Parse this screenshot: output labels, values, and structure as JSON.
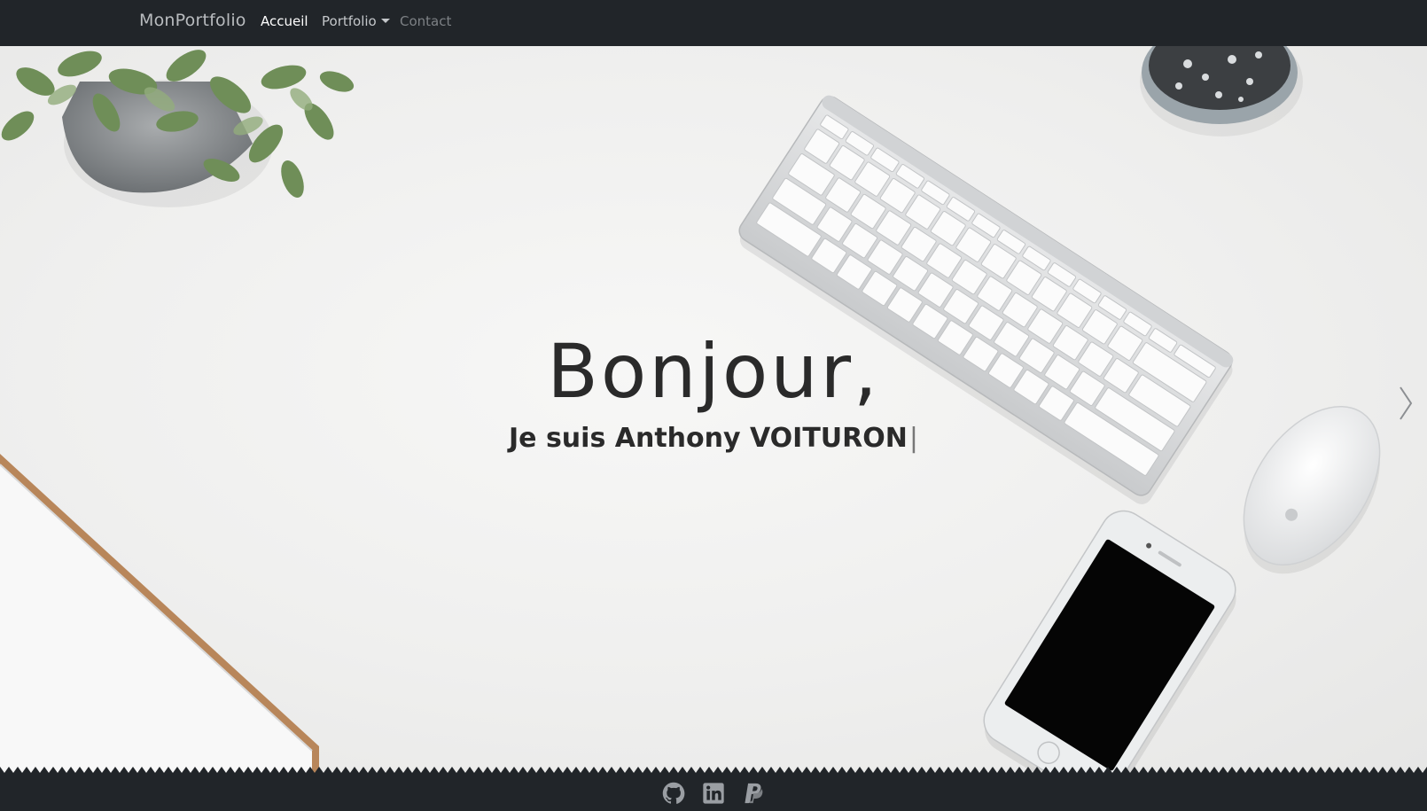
{
  "navbar": {
    "brand": "MonPortfolio",
    "items": [
      {
        "label": "Accueil",
        "active": true
      },
      {
        "label": "Portfolio",
        "dropdown": true
      },
      {
        "label": "Contact",
        "disabled": true
      }
    ]
  },
  "hero": {
    "title": "Bonjour,",
    "subtitle": "Je suis Anthony VOITURON",
    "cursor": "|",
    "next_icon": "chevron-right-icon"
  },
  "footer": {
    "socials": [
      {
        "icon": "github-icon"
      },
      {
        "icon": "linkedin-icon"
      },
      {
        "icon": "paypal-icon"
      }
    ]
  },
  "colors": {
    "navbar_bg": "#212529",
    "hero_bg": "#efefee",
    "text_dark": "#2a2a2a",
    "icon_gray": "#9a9ea3"
  }
}
